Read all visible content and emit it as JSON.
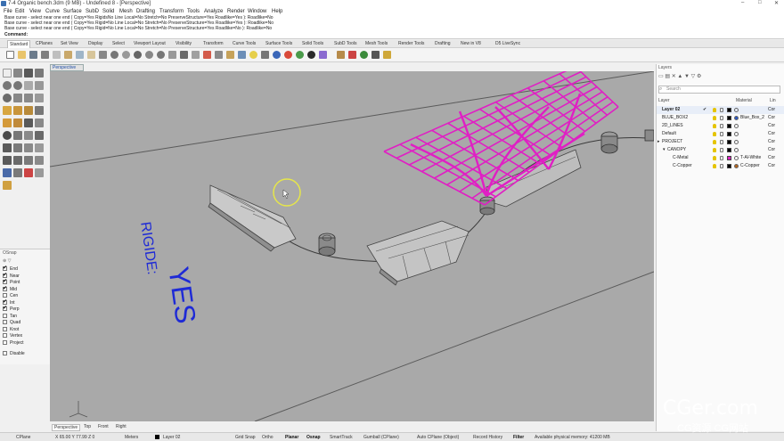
{
  "window": {
    "title": "7-4 Organic bench.3dm (9 MB) - Undefined 8 - [Perspective]",
    "controls": [
      "–",
      "□",
      "✕"
    ]
  },
  "menu": [
    "File",
    "Edit",
    "View",
    "Curve",
    "Surface",
    "SubD",
    "Solid",
    "Mesh",
    "Drafting",
    "Transform",
    "Tools",
    "Analyze",
    "Render",
    "Window",
    "Help"
  ],
  "command_history": [
    "Base curve - select near one end ( Copy=Yes  RigidsNo  Line  Local=No  Stretch=No  PreserveStructure=Yes  Roadlike=Yes ): Roadlike=No",
    "Base curve - select near one end ( Copy=Yes  Rigid=No  Line  Local=No  Stretch=No  PreserveStructure=Yes  Roadlike=Yes ): Roadlike=No",
    "Base curve - select near one end ( Copy=Yes  Rigid=No  Line  Local=No  Stretch=No  PreserveStructure=Yes  Roadlike=No ): Roadlike=No"
  ],
  "command_prompt": "Command:",
  "toolbar_tabs": [
    "Standard",
    "CPlanes",
    "Set View",
    "Display",
    "Select",
    "Viewport Layout",
    "Visibility",
    "Transform",
    "Curve Tools",
    "Surface Tools",
    "Solid Tools",
    "SubD Tools",
    "Mesh Tools",
    "Render Tools",
    "Drafting",
    "New in V8",
    "D5 LiveSync"
  ],
  "toolbar_tabs_active": "Standard",
  "viewport": {
    "title": "Perspective",
    "annotation_label": "RIGIDE:",
    "annotation_value": "YES",
    "bottom_tabs": [
      "Perspective",
      "Top",
      "Front",
      "Right"
    ],
    "bottom_tabs_active": "Perspective",
    "colors": {
      "background": "#a9a9a9",
      "canopy": "#e01fc4",
      "annotation": "#1e2ad6"
    }
  },
  "osnap": {
    "title": "OSnap",
    "items": [
      {
        "label": "End",
        "checked": true
      },
      {
        "label": "Near",
        "checked": true
      },
      {
        "label": "Point",
        "checked": true
      },
      {
        "label": "Mid",
        "checked": true
      },
      {
        "label": "Cen",
        "checked": false
      },
      {
        "label": "Int",
        "checked": true
      },
      {
        "label": "Perp",
        "checked": true
      },
      {
        "label": "Tan",
        "checked": false
      },
      {
        "label": "Quad",
        "checked": false
      },
      {
        "label": "Knot",
        "checked": false
      },
      {
        "label": "Vertex",
        "checked": false
      },
      {
        "label": "Project",
        "checked": false
      }
    ],
    "disable_label": "Disable"
  },
  "layers": {
    "panel_title": "Layers",
    "search_placeholder": "Search",
    "col_layer": "Layer",
    "col_material": "Material",
    "col_linetype": "Lin",
    "rows": [
      {
        "name": "Layer 02",
        "indent": 0,
        "current": true,
        "color": "#000000",
        "material": "",
        "linetype": "Cor"
      },
      {
        "name": "BLUE_BOX2",
        "indent": 0,
        "current": false,
        "color": "#000000",
        "material": "Blue_Box_2",
        "linetype": "Cor"
      },
      {
        "name": "2D_LINES",
        "indent": 0,
        "current": false,
        "color": "#000000",
        "material": "",
        "linetype": "Cor"
      },
      {
        "name": "Default",
        "indent": 0,
        "current": false,
        "color": "#000000",
        "material": "",
        "linetype": "Cor"
      },
      {
        "name": "PROJECT",
        "indent": 0,
        "current": false,
        "expander": "▸",
        "color": "#000000",
        "material": "",
        "linetype": "Cor"
      },
      {
        "name": "CANOPY",
        "indent": 1,
        "current": false,
        "expander": "▾",
        "color": "#000000",
        "material": "",
        "linetype": "Cor"
      },
      {
        "name": "C-Metal",
        "indent": 2,
        "current": false,
        "color": "#e01fc4",
        "material": "T-Al-White",
        "linetype": "Cor"
      },
      {
        "name": "C-Copper",
        "indent": 2,
        "current": false,
        "color": "#000000",
        "material": "C-Copper",
        "linetype": "Cor"
      }
    ]
  },
  "status": {
    "cplane": "CPlane",
    "coords": "X 65.00 Y 77.99 Z 0",
    "units": "Meters",
    "layer": "Layer 02",
    "toggles": [
      "Grid Snap",
      "Ortho",
      "Planar",
      "Osnap",
      "SmartTrack",
      "Gumball (CPlane)",
      "Auto CPlane (Object)",
      "Record History",
      "Filter"
    ],
    "bold_toggles": [
      "Planar",
      "Osnap",
      "Filter"
    ],
    "memory": "Available physical memory: 41200 MB"
  },
  "watermark": {
    "main": "CGer.com",
    "sub": "CG资源 CG网站"
  }
}
